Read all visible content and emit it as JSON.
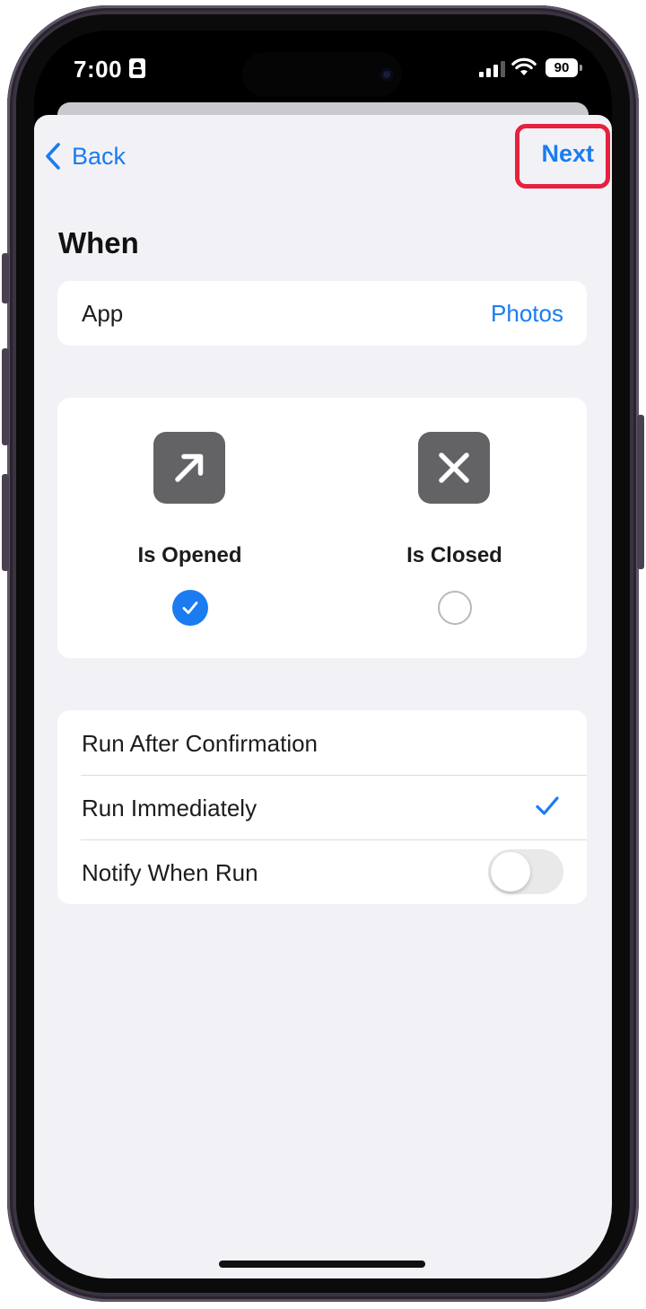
{
  "status_bar": {
    "time": "7:00",
    "battery": "90"
  },
  "nav": {
    "back_label": "Back",
    "next_label": "Next"
  },
  "section": {
    "title": "When"
  },
  "app_row": {
    "label": "App",
    "value": "Photos"
  },
  "triggers": [
    {
      "label": "Is Opened",
      "icon": "arrow-up-right-icon",
      "selected": true
    },
    {
      "label": "Is Closed",
      "icon": "x-mark-icon",
      "selected": false
    }
  ],
  "run_options": [
    {
      "label": "Run After Confirmation",
      "selected": false
    },
    {
      "label": "Run Immediately",
      "selected": true
    },
    {
      "label": "Notify When Run",
      "toggle_on": false
    }
  ],
  "colors": {
    "accent": "#1a7cf0",
    "highlight": "#e5213f",
    "background": "#f2f2f6",
    "icon_tile": "#636366"
  }
}
